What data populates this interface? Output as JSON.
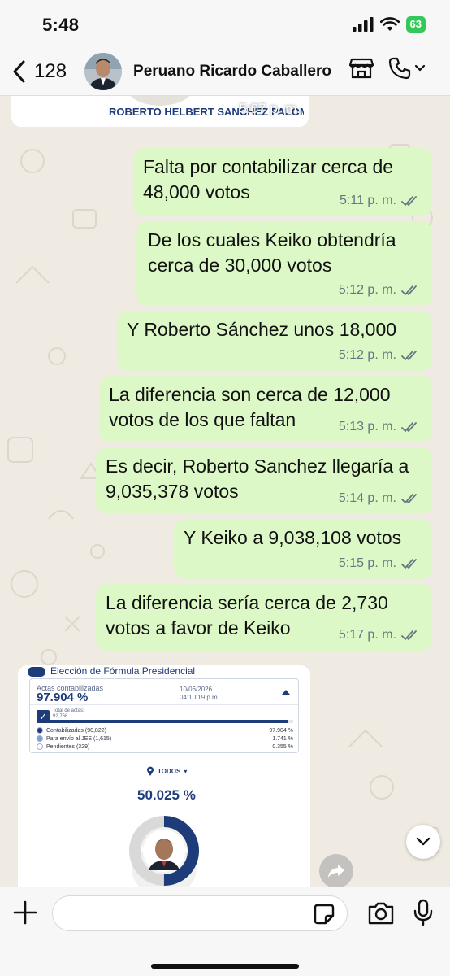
{
  "status_bar": {
    "time": "5:48",
    "battery": "63"
  },
  "header": {
    "back_count": "128",
    "contact_name": "Peruano Ricardo Caballero"
  },
  "chat": {
    "image_top": {
      "caption": "ROBERTO HELBERT SANCHEZ PALOMINO",
      "time": "5:07 p. m."
    },
    "messages": [
      {
        "text": "Falta por contabilizar cerca de 48,000 votos",
        "time": "5:11 p. m."
      },
      {
        "text": "De los cuales Keiko obtendría cerca de 30,000 votos",
        "time": "5:12 p. m."
      },
      {
        "text": "Y Roberto Sánchez unos 18,000",
        "time": "5:12 p. m."
      },
      {
        "text": "La diferencia son cerca de 12,000 votos de los que faltan",
        "time": "5:13 p. m."
      },
      {
        "text": "Es decir, Roberto Sanchez llegaría a 9,035,378 votos",
        "time": "5:14 p. m."
      },
      {
        "text": "Y Keiko a 9,038,108 votos",
        "time": "5:15 p. m."
      },
      {
        "text": "La diferencia sería cerca de 2,730 votos a favor de Keiko",
        "time": "5:17 p. m."
      }
    ],
    "image_card": {
      "title": "Elección de Fórmula Presidencial",
      "actas_label": "Actas contabilizadas",
      "actas_pct": "97.904 %",
      "date": "10/06/2026",
      "clock": "04:10:19 p.m.",
      "total_label": "Total de actas:",
      "total_value": "92,766",
      "progress": 0.97904,
      "rows": [
        {
          "label": "Contabilizadas (90,822)",
          "value": "97.904 %",
          "color": "#1e3c7a"
        },
        {
          "label": "Para envío al JEE (1,615)",
          "value": "1.741 %",
          "color": "#7aa2d8"
        },
        {
          "label": "Pendientes (329)",
          "value": "0.355 %",
          "color": "#ffffff"
        }
      ],
      "filter": "TODOS",
      "candidate_pct": "50.025 %",
      "candidate_share": 0.50025
    }
  },
  "input": {
    "placeholder": ""
  },
  "colors": {
    "bubble_out": "#dcf8c6",
    "chat_bg": "#efeae2",
    "ticks": "#667781",
    "brand": "#1e3c7a"
  }
}
